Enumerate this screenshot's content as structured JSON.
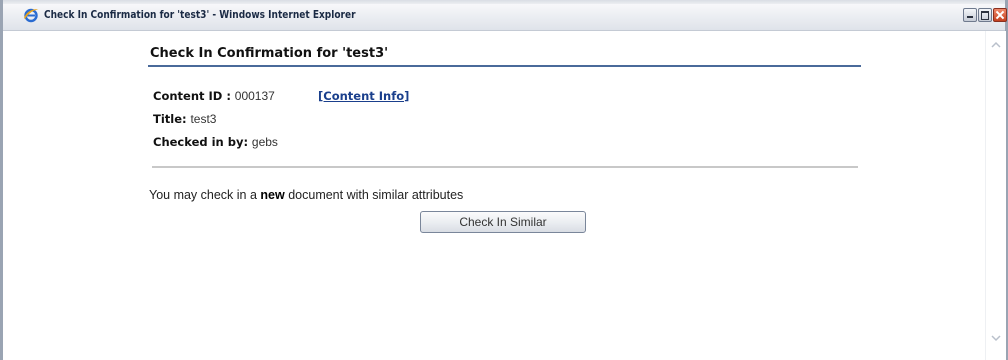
{
  "window": {
    "title": "Check In Confirmation for 'test3' - Windows Internet Explorer",
    "icon": "ie-icon",
    "controls": [
      "minimize",
      "maximize",
      "close"
    ]
  },
  "page": {
    "heading": "Check In Confirmation for 'test3'",
    "content_id_label": "Content ID :",
    "content_id_value": "000137",
    "content_info_link": "[Content Info]",
    "title_label": "Title:",
    "title_value": "test3",
    "checked_in_by_label": "Checked in by:",
    "checked_in_by_value": "gebs",
    "similar_prefix": "You may check in a ",
    "similar_bold": "new",
    "similar_suffix": " document with similar attributes",
    "similar_button": "Check In Similar"
  },
  "colors": {
    "heading_rule": "#4a6a9a",
    "link": "#1a3f8c",
    "divider": "#c8c8c8"
  }
}
